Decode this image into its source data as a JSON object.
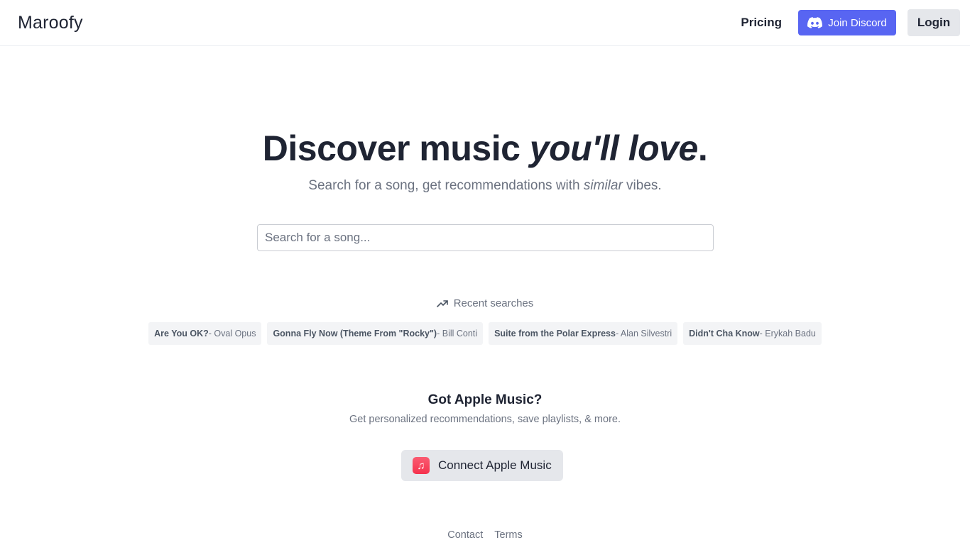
{
  "header": {
    "logo": "Maroofy",
    "pricing_label": "Pricing",
    "discord_label": "Join Discord",
    "login_label": "Login"
  },
  "hero": {
    "title_plain": "Discover music ",
    "title_italic": "you'll love",
    "title_end": ".",
    "subtitle_pre": "Search for a song, get recommendations with ",
    "subtitle_italic": "similar",
    "subtitle_post": " vibes."
  },
  "search": {
    "placeholder": "Search for a song...",
    "value": ""
  },
  "recent": {
    "label": "Recent searches",
    "items": [
      {
        "song": "Are You OK?",
        "artist": " - Oval Opus"
      },
      {
        "song": "Gonna Fly Now (Theme From \"Rocky\")",
        "artist": " - Bill Conti"
      },
      {
        "song": "Suite from the Polar Express",
        "artist": " - Alan Silvestri"
      },
      {
        "song": "Didn't Cha Know",
        "artist": " - Erykah Badu"
      }
    ]
  },
  "apple_music": {
    "title": "Got Apple Music?",
    "subtitle": "Get personalized recommendations, save playlists, & more.",
    "button_label": "Connect Apple Music"
  },
  "footer": {
    "contact": "Contact",
    "terms": "Terms"
  },
  "colors": {
    "discord": "#5865f2",
    "apple_music": "#f5324d",
    "text_primary": "#1f2433",
    "text_muted": "#6b7280"
  }
}
